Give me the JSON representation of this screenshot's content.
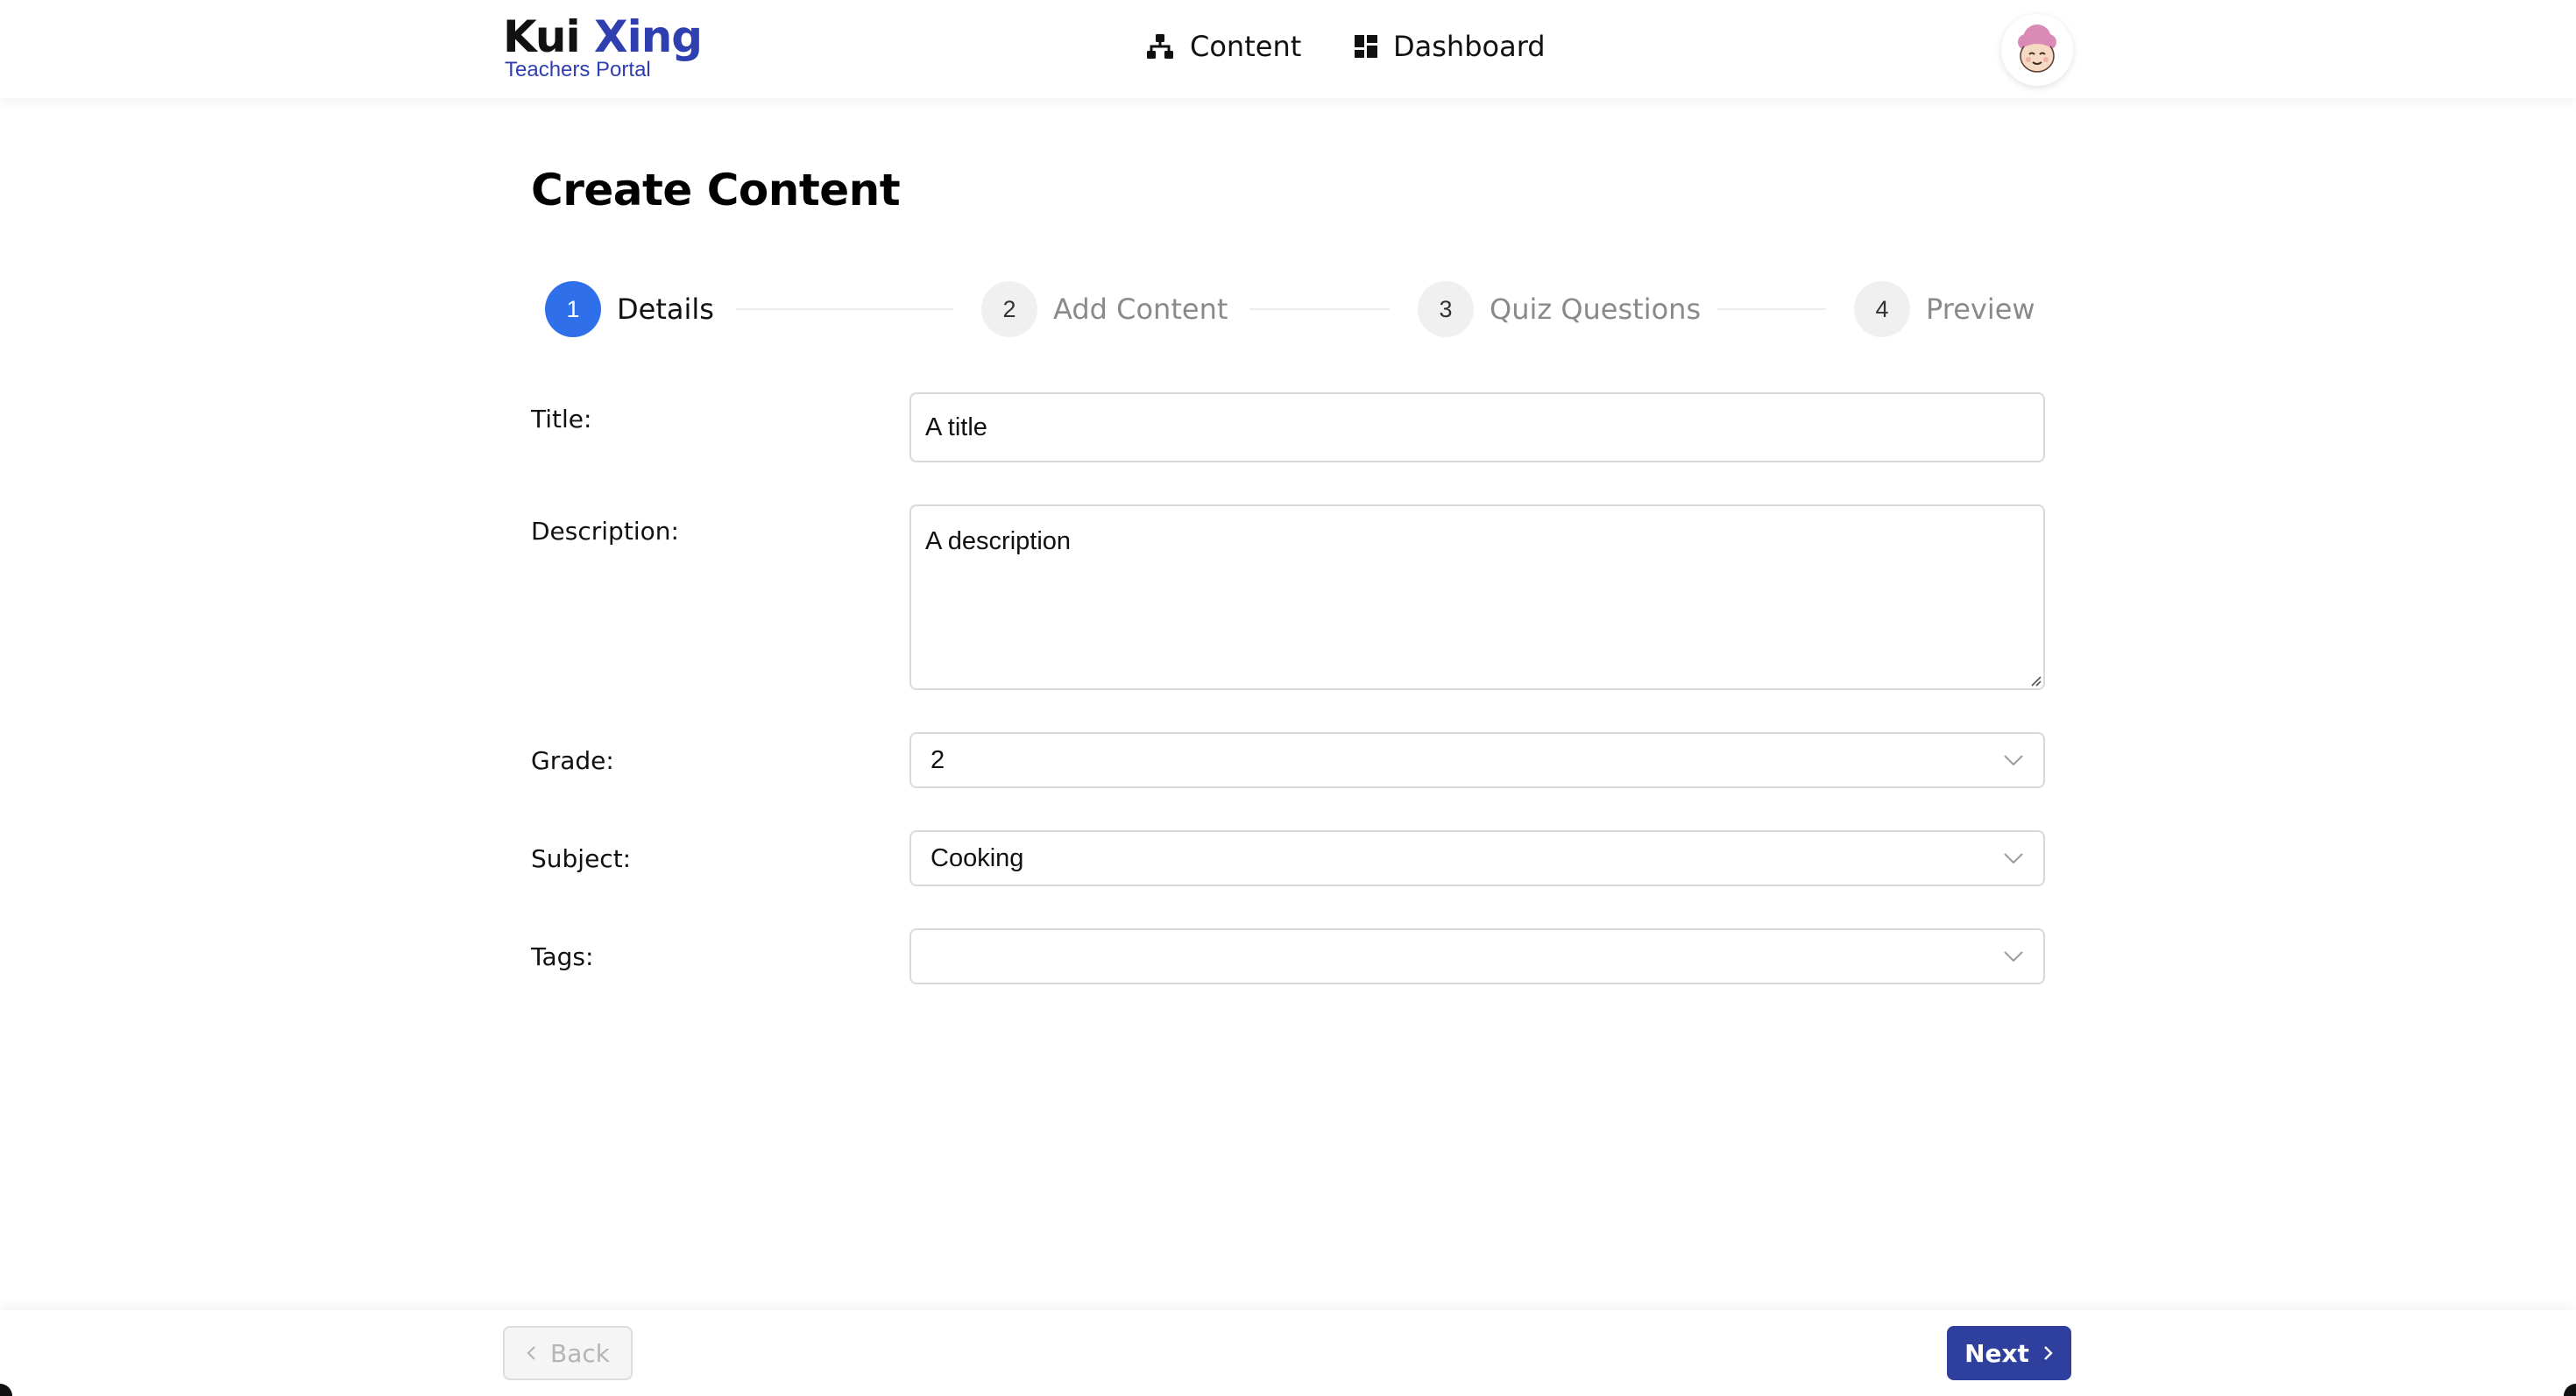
{
  "header": {
    "logo_part1": "Kui ",
    "logo_part2": "Xing",
    "logo_subtitle": "Teachers Portal",
    "nav": {
      "content_label": "Content",
      "content_icon": "sitemap-icon",
      "dashboard_label": "Dashboard",
      "dashboard_icon": "dashboard-icon"
    },
    "avatar_icon": "user-avatar-icon"
  },
  "page": {
    "title": "Create Content"
  },
  "stepper": {
    "steps": [
      {
        "number": "1",
        "label": "Details",
        "active": true
      },
      {
        "number": "2",
        "label": "Add Content",
        "active": false
      },
      {
        "number": "3",
        "label": "Quiz Questions",
        "active": false
      },
      {
        "number": "4",
        "label": "Preview",
        "active": false
      }
    ]
  },
  "form": {
    "title_label": "Title",
    "title_value": "A title",
    "description_label": "Description",
    "description_value": "A description",
    "grade_label": "Grade",
    "grade_value": "2",
    "subject_label": "Subject",
    "subject_value": "Cooking",
    "tags_label": "Tags",
    "tags_value": "",
    "label_suffix": ":"
  },
  "footer": {
    "back_label": "Back",
    "next_label": "Next"
  },
  "colors": {
    "brand": "#2f3fb0",
    "active_step": "#2f6fea",
    "next_button": "#2f3f9e"
  }
}
